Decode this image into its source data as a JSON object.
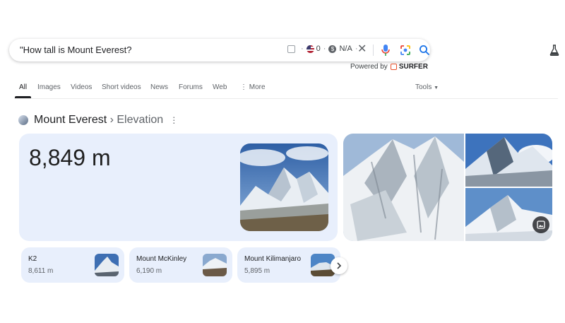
{
  "search": {
    "query": "\"How tall is Mount Everest?",
    "ext_count": "0",
    "ext_value": "N/A",
    "ext_dot": "·"
  },
  "powered": {
    "label": "Powered by",
    "brand": "SURFER"
  },
  "tabs": [
    {
      "label": "All",
      "active": true
    },
    {
      "label": "Images"
    },
    {
      "label": "Videos"
    },
    {
      "label": "Short videos"
    },
    {
      "label": "News"
    },
    {
      "label": "Forums"
    },
    {
      "label": "Web"
    },
    {
      "label": "More"
    }
  ],
  "tools_label": "Tools",
  "knowledge": {
    "title": "Mount Everest",
    "separator": " › ",
    "subtitle": "Elevation",
    "answer": "8,849 m"
  },
  "related": [
    {
      "name": "K2",
      "value": "8,611 m"
    },
    {
      "name": "Mount McKinley",
      "value": "6,190 m"
    },
    {
      "name": "Mount Kilimanjaro",
      "value": "5,895 m"
    }
  ],
  "icons": {
    "checkbox": "checkbox-icon",
    "flag": "us-flag-icon",
    "dollar": "dollar-icon",
    "clear": "close-icon",
    "mic": "mic-icon",
    "lens": "lens-icon",
    "search": "search-icon",
    "labs": "flask-icon",
    "more": "kebab-icon",
    "tools": "caret-down-icon",
    "gallery": "image-icon",
    "next": "chevron-right-icon"
  },
  "colors": {
    "card_bg": "#e8effc",
    "accent_blue": "#1a73e8",
    "surfer_orange": "#e8502b"
  }
}
